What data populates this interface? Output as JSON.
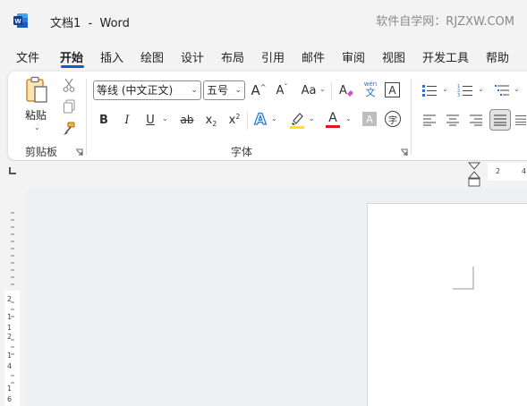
{
  "titlebar": {
    "app_icon": "word-app-icon",
    "doc_title": "文档1  -  Word",
    "watermark": "软件自学网：RJZXW.COM"
  },
  "tabs": [
    {
      "label": "文件",
      "active": false
    },
    {
      "label": "开始",
      "active": true
    },
    {
      "label": "插入",
      "active": false
    },
    {
      "label": "绘图",
      "active": false
    },
    {
      "label": "设计",
      "active": false
    },
    {
      "label": "布局",
      "active": false
    },
    {
      "label": "引用",
      "active": false
    },
    {
      "label": "邮件",
      "active": false
    },
    {
      "label": "审阅",
      "active": false
    },
    {
      "label": "视图",
      "active": false
    },
    {
      "label": "开发工具",
      "active": false
    },
    {
      "label": "帮助",
      "active": false
    }
  ],
  "clipboard": {
    "paste_label": "粘贴",
    "group_label": "剪贴板",
    "icons": [
      "paste-icon",
      "cut-icon",
      "copy-icon",
      "format-painter-icon"
    ]
  },
  "font": {
    "font_name": "等线 (中文正文)",
    "font_size": "五号",
    "group_label": "字体",
    "grow_label": "A",
    "shrink_label": "A",
    "case_label": "Aa",
    "phonetic_top": "wén",
    "phonetic_bottom": "文",
    "border_char": "A",
    "bold": "B",
    "italic": "I",
    "underline": "U",
    "strike": "ab",
    "subscript": "x",
    "subscript_mark": "2",
    "superscript": "x",
    "superscript_mark": "2",
    "effects": "A",
    "font_color_char": "A",
    "shading_char": "A",
    "enclose_char": "字",
    "highlight_color": "#ffe600",
    "font_color": "#e81123"
  },
  "paragraph": {
    "icons": [
      "bullets-icon",
      "numbering-icon",
      "multilevel-list-icon",
      "align-left-icon",
      "align-center-icon",
      "align-right-icon",
      "justify-icon",
      "distributed-icon"
    ]
  },
  "ruler": {
    "h_numbers": [
      "2",
      "4"
    ],
    "v_numbers": [
      "2",
      "1",
      "1",
      "2",
      "1",
      "4",
      "1",
      "6"
    ]
  },
  "colors": {
    "accent": "#185abd",
    "word_blue": "#185abd",
    "highlight": "#ffe600",
    "font_red": "#e81123"
  }
}
